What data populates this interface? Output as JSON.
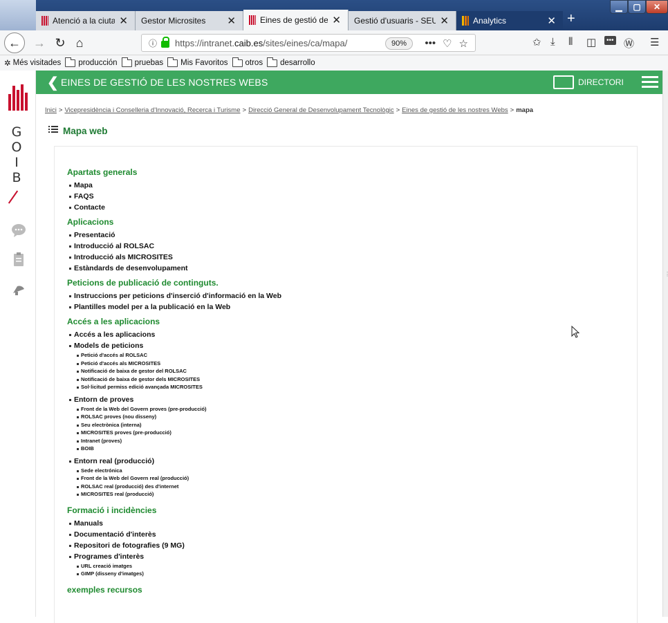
{
  "browser": {
    "tabs": [
      {
        "label": "Atenció a la ciutada",
        "favicon": "caib-icon"
      },
      {
        "label": "Gestor Microsites",
        "favicon": "none"
      },
      {
        "label": "Eines de gestió de la",
        "favicon": "caib-icon"
      },
      {
        "label": "Gestió d'usuaris - SEU: SE",
        "favicon": "none"
      },
      {
        "label": "Analytics",
        "favicon": "analytics-icon"
      }
    ],
    "new_tab": "+",
    "url": "https://intranet.caib.es/sites/eines/ca/mapa/",
    "url_prefix": "https://intranet.",
    "url_domain": "caib.es",
    "url_path": "/sites/eines/ca/mapa/",
    "zoom": "90%",
    "bookmarks": [
      {
        "label": "Més visitades",
        "icon": "gear-icon"
      },
      {
        "label": "producción",
        "icon": "folder-icon"
      },
      {
        "label": "pruebas",
        "icon": "folder-icon"
      },
      {
        "label": "Mis Favoritos",
        "icon": "folder-icon"
      },
      {
        "label": "otros",
        "icon": "folder-icon"
      },
      {
        "label": "desarrollo",
        "icon": "folder-icon"
      }
    ]
  },
  "sidebar": {
    "logo_letters": [
      "G",
      "O",
      "I",
      "B"
    ]
  },
  "header": {
    "title": "EINES DE GESTIÓ DE LES NOSTRES WEBS",
    "directory_label": "DIRECTORI",
    "accent_color": "#3ea85f"
  },
  "breadcrumb": {
    "items": [
      "Inici",
      "Vicepresidència i Conselleria d'Innovació, Recerca i Turisme",
      "Direcció General de Desenvolupament Tecnològic",
      "Eines de gestió de les nostres Webs"
    ],
    "current": "mapa",
    "separator": ">"
  },
  "page": {
    "title": "Mapa web"
  },
  "sitemap": {
    "sections": [
      {
        "title": "Apartats generals",
        "items": [
          {
            "label": "Mapa"
          },
          {
            "label": "FAQS"
          },
          {
            "label": "Contacte"
          }
        ]
      },
      {
        "title": "Aplicacions",
        "items": [
          {
            "label": "Presentació"
          },
          {
            "label": "Introducció al ROLSAC"
          },
          {
            "label": "Introducció als MICROSITES"
          },
          {
            "label": "Estàndards de desenvolupament"
          }
        ]
      },
      {
        "title": "Peticions de publicació de continguts.",
        "items": [
          {
            "label": "Instruccions per peticions d'inserció d'informació en la Web"
          },
          {
            "label": "Plantilles model per a la publicació en la Web"
          }
        ]
      },
      {
        "title": "Accés a les aplicacions",
        "items": [
          {
            "label": "Accés a les aplicacions"
          },
          {
            "label": "Models de peticions",
            "children": [
              "Petició d'accés al ROLSAC",
              "Petició d'accés als MICROSITES",
              "Notificació de baixa de gestor del ROLSAC",
              "Notificació de baixa de gestor dels MICROSITES",
              "Sol·licitud permiss edició avançada MICROSITES"
            ]
          },
          {
            "label": "Entorn de proves",
            "children": [
              "Front de la Web del Govern proves (pre-producció)",
              "ROLSAC proves (nou disseny)",
              "Seu electrònica (interna)",
              "MICROSITES proves (pre-producció)",
              "Intranet (proves)",
              "BOIB"
            ]
          },
          {
            "label": "Entorn real (producció)",
            "children": [
              "Sede electrónica",
              "Front de la Web del Govern real (producció)",
              "ROLSAC real (producció) des d'internet",
              "MICROSITES real (producció)"
            ]
          }
        ]
      },
      {
        "title": "Formació i incidències",
        "items": [
          {
            "label": "Manuals"
          },
          {
            "label": "Documentació d'interès"
          },
          {
            "label": "Repositori de fotografies (9 MG)"
          },
          {
            "label": "Programes d'interès",
            "children": [
              "URL creació imatges",
              "GIMP (disseny d'imatges)"
            ]
          }
        ]
      },
      {
        "title": "exemples recursos",
        "items": []
      }
    ]
  }
}
